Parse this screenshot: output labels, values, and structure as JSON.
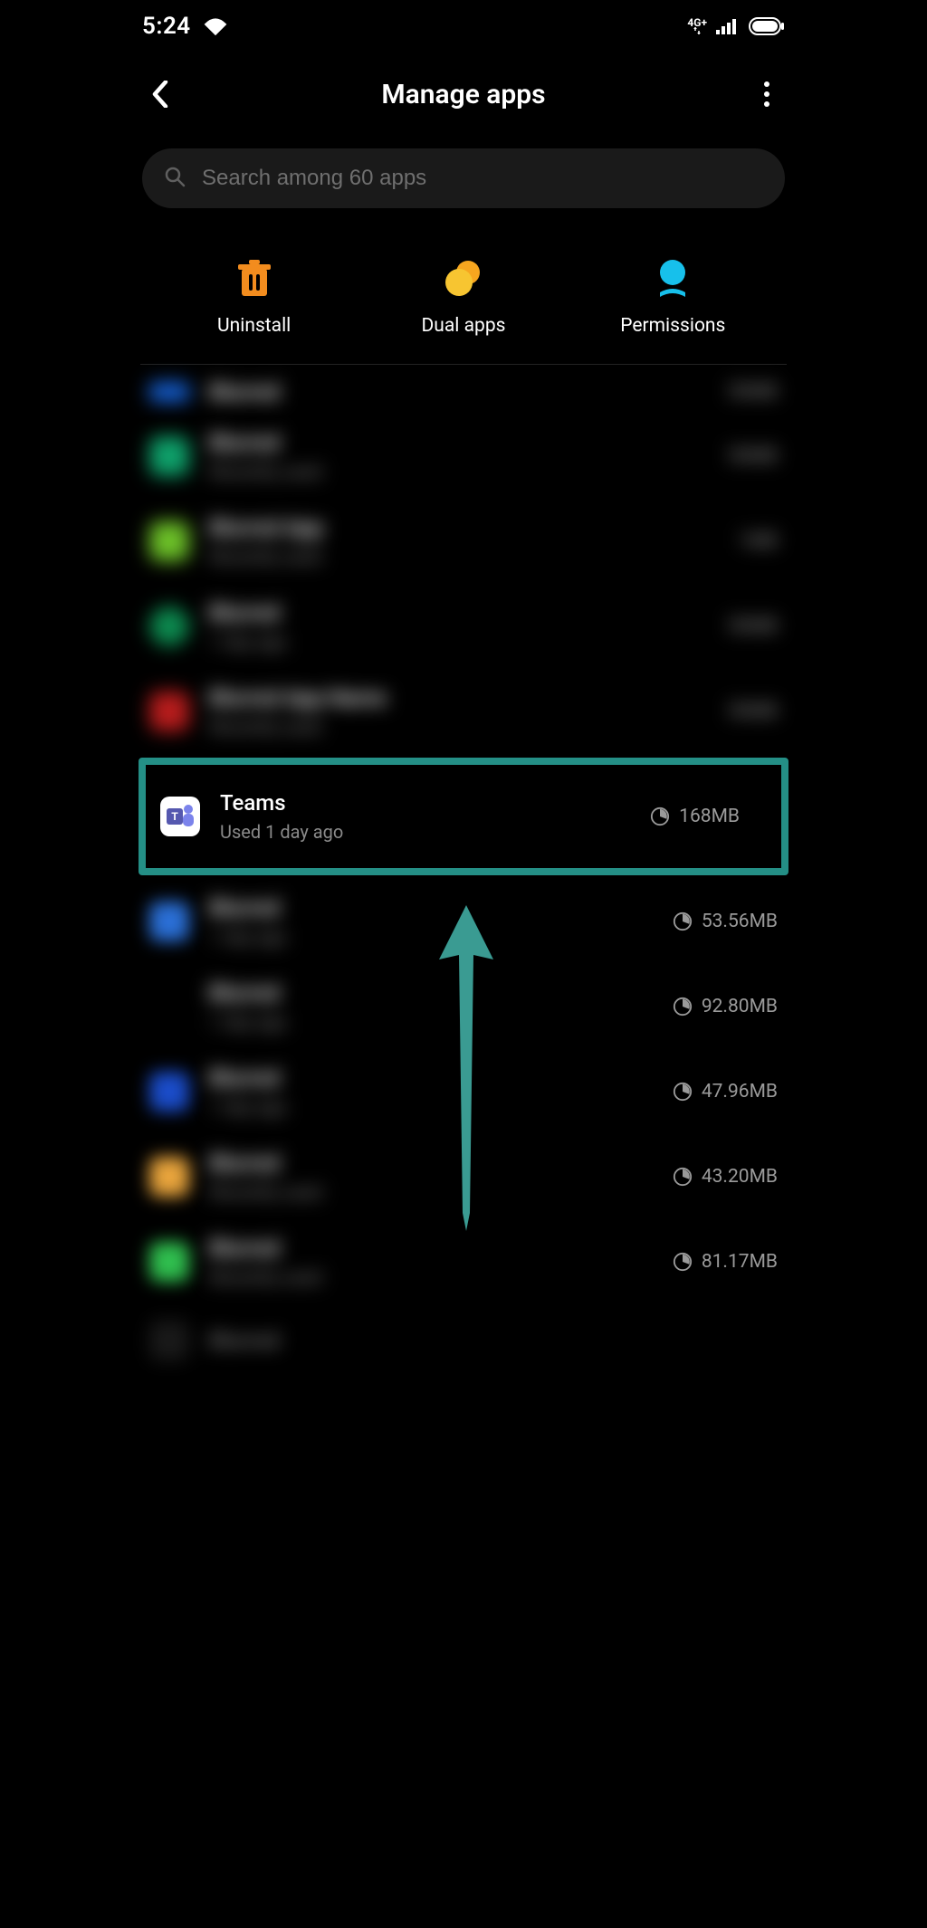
{
  "status": {
    "time": "5:24",
    "network_label": "4G+"
  },
  "header": {
    "title": "Manage apps"
  },
  "search": {
    "placeholder": "Search among 60 apps"
  },
  "actions": {
    "uninstall": "Uninstall",
    "dual": "Dual apps",
    "permissions": "Permissions"
  },
  "apps": {
    "teams": {
      "name": "Teams",
      "sub": "Used 1 day ago",
      "size": "168MB"
    },
    "r1": {
      "size": "53.56MB"
    },
    "r2": {
      "size": "92.80MB"
    },
    "r3": {
      "size": "47.96MB"
    },
    "r4": {
      "size": "43.20MB"
    },
    "r5": {
      "size": "81.17MB"
    }
  },
  "colors": {
    "highlight": "#248f86",
    "trash": "#f28c1e",
    "dual": "#f7c531",
    "perm": "#17c0eb"
  }
}
